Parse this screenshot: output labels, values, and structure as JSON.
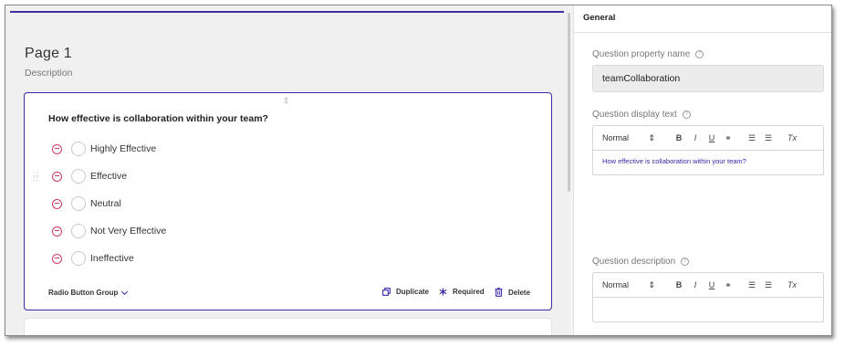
{
  "designer": {
    "page_title": "Page 1",
    "page_description": "Description",
    "question": {
      "title": "How effective is collaboration within your team?",
      "choices": [
        "Highly Effective",
        "Effective",
        "Neutral",
        "Not Very Effective",
        "Ineffective"
      ],
      "type_label": "Radio Button Group",
      "actions": {
        "duplicate": "Duplicate",
        "required": "Required",
        "delete": "Delete"
      }
    }
  },
  "properties": {
    "header": "General",
    "name_label": "Question property name",
    "name_value": "teamCollaboration",
    "display_text_label": "Question display text",
    "display_text_value": "How effective is collaboration within your team?",
    "description_label": "Question description",
    "toolbar": {
      "style": "Normal",
      "bold": "B",
      "italic": "I",
      "underline": "U",
      "clear": "Tx"
    }
  },
  "colors": {
    "accent": "#3826a8",
    "remove": "#d13a62"
  },
  "icons": [
    "drag-handle-icon",
    "remove-circle-icon",
    "chevron-down-icon",
    "duplicate-icon",
    "asterisk-icon",
    "trash-icon",
    "help-icon",
    "link-icon",
    "ordered-list-icon",
    "bullet-list-icon"
  ]
}
